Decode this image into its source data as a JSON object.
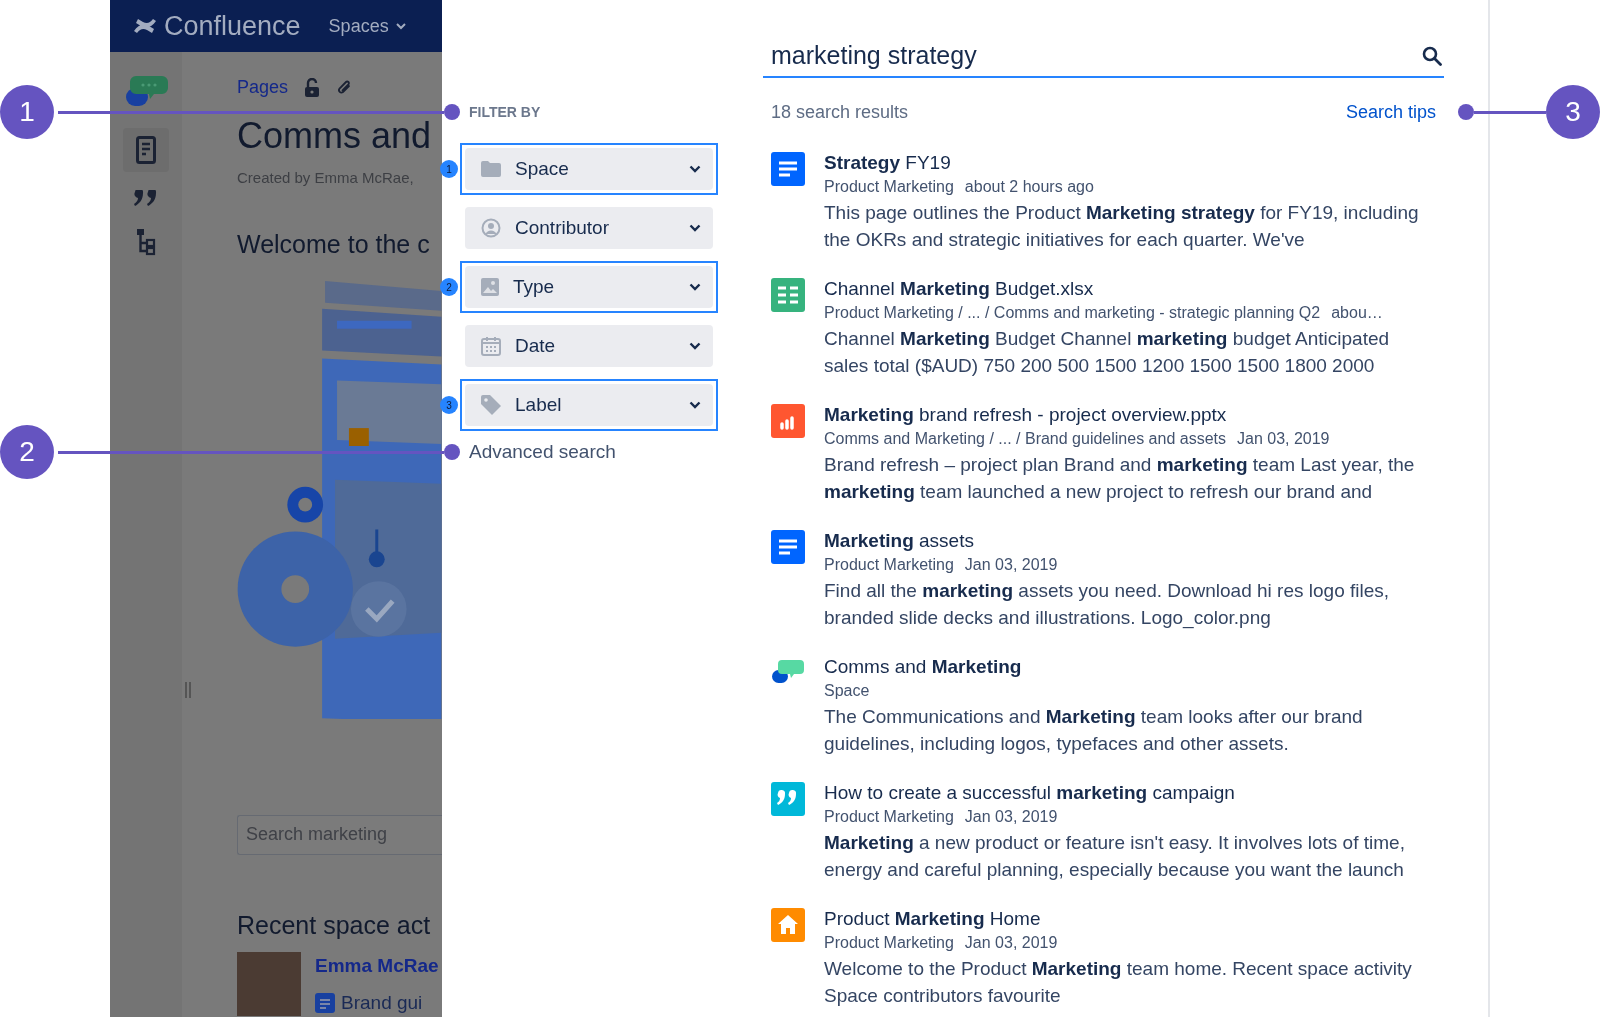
{
  "app": {
    "logo": "Confluence",
    "nav_menu": "Spaces"
  },
  "space_page": {
    "breadcrumb": "Pages",
    "title": "Comms and",
    "byline": "Created by Emma McRae,",
    "heading": "Welcome to the c",
    "search_placeholder": "Search marketing",
    "recent_heading": "Recent space act",
    "activity_user": "Emma McRae",
    "activity_item": "Brand gui"
  },
  "search": {
    "query": "marketing strategy",
    "result_count": "18 search results",
    "tips_link": "Search tips",
    "filter_heading": "FILTER BY",
    "filters": [
      {
        "label": "Space",
        "highlighted": true,
        "badge": "1"
      },
      {
        "label": "Contributor",
        "highlighted": false
      },
      {
        "label": "Type",
        "highlighted": true,
        "badge": "2"
      },
      {
        "label": "Date",
        "highlighted": false
      },
      {
        "label": "Label",
        "highlighted": true,
        "badge": "3"
      }
    ],
    "advanced_link": "Advanced search",
    "results": [
      {
        "kind": "page",
        "title": "**Strategy** FY19",
        "meta": [
          "Product Marketing",
          "about 2 hours ago"
        ],
        "snippet": "This page outlines the Product **Marketing strategy** for FY19, including the OKRs and strategic initiatives for each quarter. We've"
      },
      {
        "kind": "spreadsheet",
        "title": "Channel **Marketing** Budget.xlsx",
        "meta": [
          "Product Marketing / ... / Comms and marketing - strategic planning Q2",
          "abou…"
        ],
        "snippet": "Channel **Marketing** Budget Channel **marketing** budget Anticipated sales total ($AUD) 750 200 500 1500 1200 1500 1500 1800 2000"
      },
      {
        "kind": "presentation",
        "title": "**Marketing** brand refresh - project overview.pptx",
        "meta": [
          "Comms and Marketing / ... / Brand guidelines and assets",
          "Jan 03, 2019"
        ],
        "snippet": "Brand refresh – project plan Brand and **marketing** team Last year, the **marketing** team launched a new project to refresh our brand and"
      },
      {
        "kind": "page",
        "title": "**Marketing** assets",
        "meta": [
          "Product Marketing",
          "Jan 03, 2019"
        ],
        "snippet": "Find all the **marketing** assets you need. Download hi res logo files, branded slide decks and illustrations. Logo_color.png"
      },
      {
        "kind": "space",
        "title": "Comms and **Marketing**",
        "meta": [
          "Space"
        ],
        "snippet": "The Communications and **Marketing** team looks after our brand guidelines, including logos, typefaces and other assets."
      },
      {
        "kind": "blog",
        "title": "How to create a successful **marketing** campaign",
        "meta": [
          "Product Marketing",
          "Jan 03, 2019"
        ],
        "snippet": "**Marketing** a new product or feature isn't easy. It involves lots of time, energy and careful planning, especially because you want the launch"
      },
      {
        "kind": "home",
        "title": "Product **Marketing** Home",
        "meta": [
          "Product Marketing",
          "Jan 03, 2019"
        ],
        "snippet": "Welcome to the Product **Marketing** team home. Recent space activity Space contributors favourite"
      }
    ]
  },
  "callouts": [
    {
      "number": "1"
    },
    {
      "number": "2"
    },
    {
      "number": "3"
    }
  ]
}
